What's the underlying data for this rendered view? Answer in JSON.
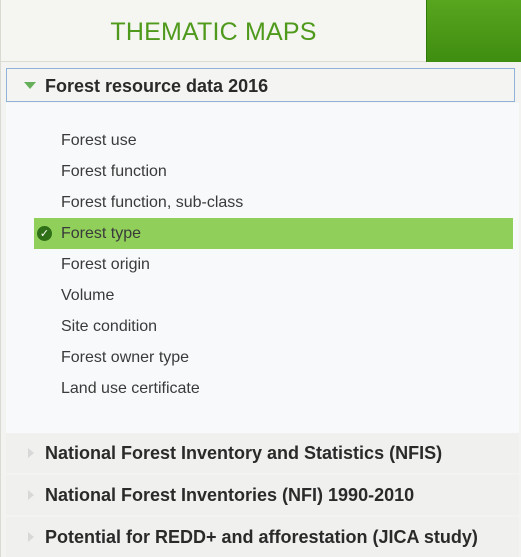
{
  "header": {
    "title": "THEMATIC MAPS"
  },
  "sections": [
    {
      "title": "Forest resource data 2016",
      "expanded": true,
      "items": [
        {
          "label": "Forest use",
          "selected": false
        },
        {
          "label": "Forest function",
          "selected": false
        },
        {
          "label": "Forest function, sub-class",
          "selected": false
        },
        {
          "label": "Forest type",
          "selected": true
        },
        {
          "label": "Forest origin",
          "selected": false
        },
        {
          "label": "Volume",
          "selected": false
        },
        {
          "label": "Site condition",
          "selected": false
        },
        {
          "label": "Forest owner type",
          "selected": false
        },
        {
          "label": "Land use certificate",
          "selected": false
        }
      ]
    },
    {
      "title": "National Forest Inventory and Statistics (NFIS)",
      "expanded": false
    },
    {
      "title": "National Forest Inventories (NFI) 1990-2010",
      "expanded": false
    },
    {
      "title": "Potential for REDD+ and afforestation (JICA study)",
      "expanded": false
    }
  ],
  "colors": {
    "header_text": "#4f9a1c",
    "header_tab": "#4a9a17",
    "selected_bg": "#8fcf5a",
    "check_icon": "#2f6f17",
    "section_border": "#8fb3d9"
  }
}
